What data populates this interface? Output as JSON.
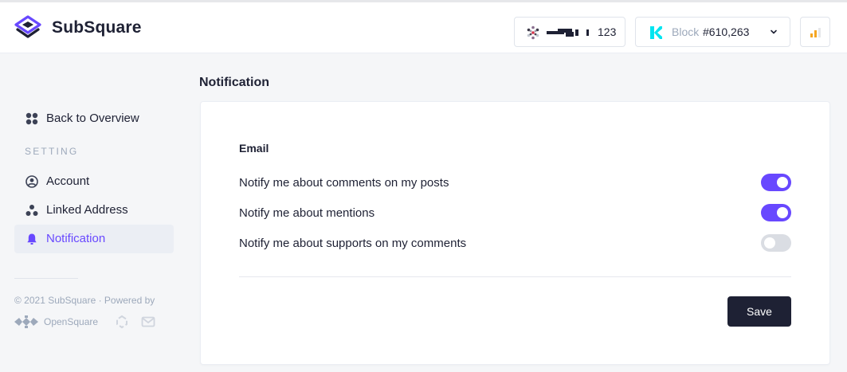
{
  "header": {
    "brand": "SubSquare",
    "account": {
      "name": "123"
    },
    "block": {
      "label": "Block",
      "number": "#610,263"
    },
    "icons": {
      "logo": "subsquare-logo-icon",
      "avatar": "polkadot-identicon-icon",
      "network": "kusama-icon",
      "dropdown": "chevron-down-icon",
      "stats": "bar-chart-icon"
    },
    "colors": {
      "accent": "#6848ff",
      "kusama": "#00e5f0",
      "stats": "#f5a623"
    }
  },
  "sidebar": {
    "back": {
      "label": "Back to Overview",
      "icon": "grid-dots-icon"
    },
    "heading": "SETTING",
    "items": [
      {
        "label": "Account",
        "icon": "user-circle-icon",
        "active": false
      },
      {
        "label": "Linked Address",
        "icon": "linked-nodes-icon",
        "active": false
      },
      {
        "label": "Notification",
        "icon": "bell-icon",
        "active": true
      }
    ],
    "footer": {
      "copyright": "© 2021 SubSquare · Powered by",
      "powered_by": "OpenSquare",
      "icons": [
        "opensquare-logo-icon",
        "element-icon",
        "mail-icon"
      ]
    }
  },
  "main": {
    "title": "Notification",
    "section": "Email",
    "options": [
      {
        "label": "Notify me about comments on my posts",
        "enabled": true
      },
      {
        "label": "Notify me about mentions",
        "enabled": true
      },
      {
        "label": "Notify me about supports on my comments",
        "enabled": false
      }
    ],
    "save_label": "Save"
  }
}
